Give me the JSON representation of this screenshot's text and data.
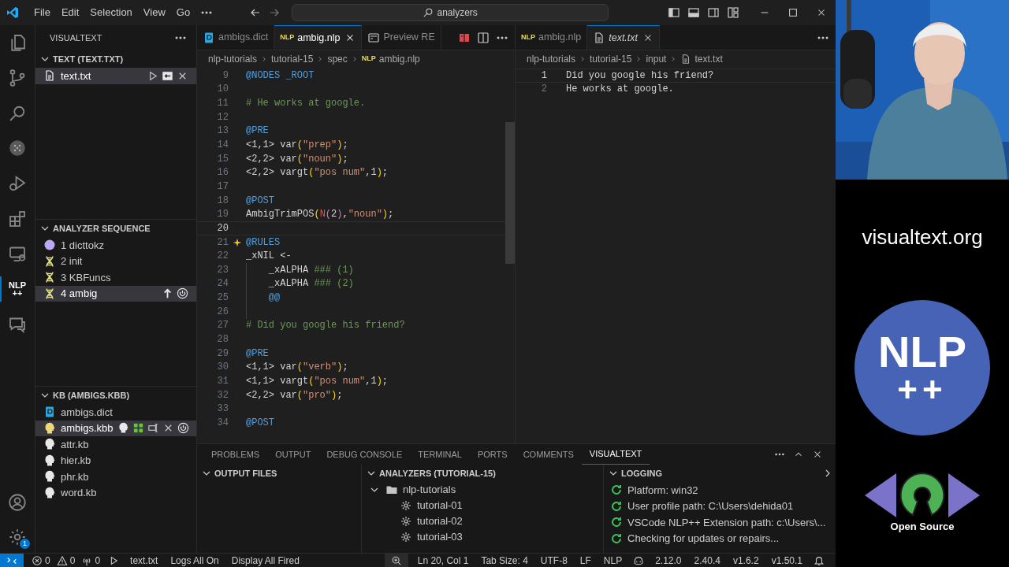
{
  "title_bar": {
    "menus": [
      "File",
      "Edit",
      "Selection",
      "View",
      "Go"
    ],
    "command_center": "analyzers"
  },
  "activity_bar": [
    {
      "kind": "explorer",
      "selected": false
    },
    {
      "kind": "source_control",
      "selected": false
    },
    {
      "kind": "search",
      "selected": false
    },
    {
      "kind": "dots",
      "selected": false
    },
    {
      "kind": "debug",
      "selected": false
    },
    {
      "kind": "extensions",
      "selected": false
    },
    {
      "kind": "remote",
      "selected": false
    },
    {
      "kind": "text",
      "label": "NLP ++",
      "selected": true
    },
    {
      "kind": "chat",
      "selected": false
    }
  ],
  "activity_bottom": [
    {
      "kind": "account"
    },
    {
      "kind": "gear",
      "badge": "1"
    }
  ],
  "sidebar": {
    "title": "VISUALTEXT",
    "sections": [
      {
        "title": "TEXT (TEXT.TXT)",
        "expanded": true,
        "items": [
          {
            "label": "text.txt",
            "kind": "file",
            "selected": true
          }
        ]
      },
      {
        "title": "ANALYZER SEQUENCE",
        "expanded": true,
        "items": [
          {
            "label": "1 dicttokz",
            "kind": "circle",
            "selected": false
          },
          {
            "label": "2 init",
            "kind": "dna",
            "selected": false
          },
          {
            "label": "3 KBFuncs",
            "kind": "dna",
            "selected": false
          },
          {
            "label": "4 ambig",
            "kind": "dna",
            "selected": true
          }
        ]
      },
      {
        "title": "KB (AMBIGS.KBB)",
        "expanded": true,
        "items": [
          {
            "label": "ambigs.dict",
            "kind": "dict",
            "selected": false
          },
          {
            "label": "ambigs.kbb",
            "kind": "head",
            "color": "#ecd77c",
            "selected": true
          },
          {
            "label": "attr.kb",
            "kind": "head",
            "color": "#e8e8e8",
            "selected": false
          },
          {
            "label": "hier.kb",
            "kind": "head",
            "color": "#e8e8e8",
            "selected": false
          },
          {
            "label": "phr.kb",
            "kind": "head",
            "color": "#e8e8e8",
            "selected": false
          },
          {
            "label": "word.kb",
            "kind": "head",
            "color": "#e8e8e8",
            "selected": false
          }
        ]
      }
    ]
  },
  "editor_groups": [
    {
      "kind": "code",
      "tabs": [
        {
          "label": "ambigs.dict",
          "kind": "dict",
          "selected": false,
          "italic": false
        },
        {
          "label": "ambig.nlp",
          "badge": "NLP",
          "selected": true,
          "italic": false
        },
        {
          "label": "Preview RE",
          "kind": "preview",
          "selected": false,
          "italic": false
        }
      ],
      "breadcrumbs": [
        {
          "label": "nlp-tutorials"
        },
        {
          "label": "tutorial-15"
        },
        {
          "label": "spec"
        },
        {
          "label": "ambig.nlp",
          "badge": "NLP"
        }
      ],
      "lines": [
        {
          "n": "9",
          "current": false,
          "hint": false,
          "guide": false,
          "tokens": [
            {
              "kind": "kw",
              "text": "@NODES _ROOT"
            }
          ]
        },
        {
          "n": "10",
          "current": false,
          "hint": false,
          "guide": false
        },
        {
          "n": "11",
          "current": false,
          "hint": false,
          "guide": false,
          "tokens": [
            {
              "kind": "comment",
              "text": "# He works at google."
            }
          ]
        },
        {
          "n": "12",
          "current": false,
          "hint": false,
          "guide": false
        },
        {
          "n": "13",
          "current": false,
          "hint": false,
          "guide": false,
          "tokens": [
            {
              "kind": "kw",
              "text": "@PRE"
            }
          ]
        },
        {
          "n": "14",
          "current": false,
          "hint": false,
          "guide": false,
          "tokens": [
            {
              "kind": "plain",
              "text": "<1,1> var"
            },
            {
              "kind": "paren",
              "text": "("
            },
            {
              "kind": "string",
              "text": "\"prep\""
            },
            {
              "kind": "paren",
              "text": ")"
            },
            {
              "kind": "plain",
              "text": ";"
            }
          ]
        },
        {
          "n": "15",
          "current": false,
          "hint": false,
          "guide": false,
          "tokens": [
            {
              "kind": "plain",
              "text": "<2,2> var"
            },
            {
              "kind": "paren",
              "text": "("
            },
            {
              "kind": "string",
              "text": "\"noun\""
            },
            {
              "kind": "paren",
              "text": ")"
            },
            {
              "kind": "plain",
              "text": ";"
            }
          ]
        },
        {
          "n": "16",
          "current": false,
          "hint": false,
          "guide": false,
          "tokens": [
            {
              "kind": "plain",
              "text": "<2,2> vargt"
            },
            {
              "kind": "paren",
              "text": "("
            },
            {
              "kind": "string",
              "text": "\"pos num\""
            },
            {
              "kind": "plain",
              "text": ",1"
            },
            {
              "kind": "paren",
              "text": ")"
            },
            {
              "kind": "plain",
              "text": ";"
            }
          ]
        },
        {
          "n": "17",
          "current": false,
          "hint": false,
          "guide": false
        },
        {
          "n": "18",
          "current": false,
          "hint": false,
          "guide": false,
          "tokens": [
            {
              "kind": "kw",
              "text": "@POST"
            }
          ]
        },
        {
          "n": "19",
          "current": false,
          "hint": false,
          "guide": false,
          "tokens": [
            {
              "kind": "plain",
              "text": "AmbigTrimPOS"
            },
            {
              "kind": "paren",
              "text": "("
            },
            {
              "kind": "macro",
              "text": "N"
            },
            {
              "kind": "paren2",
              "text": "("
            },
            {
              "kind": "plain",
              "text": "2"
            },
            {
              "kind": "paren2",
              "text": ")"
            },
            {
              "kind": "plain",
              "text": ","
            },
            {
              "kind": "string",
              "text": "\"noun\""
            },
            {
              "kind": "paren",
              "text": ")"
            },
            {
              "kind": "plain",
              "text": ";"
            }
          ]
        },
        {
          "n": "20",
          "current": true,
          "hint": false,
          "guide": false
        },
        {
          "n": "21",
          "current": false,
          "hint": true,
          "guide": false,
          "tokens": [
            {
              "kind": "kw",
              "text": "@RULES"
            }
          ]
        },
        {
          "n": "22",
          "current": false,
          "hint": false,
          "guide": false,
          "tokens": [
            {
              "kind": "plain",
              "text": "_xNIL <-"
            }
          ]
        },
        {
          "n": "23",
          "current": false,
          "hint": false,
          "guide": true,
          "tokens": [
            {
              "kind": "plain",
              "text": "_xALPHA "
            },
            {
              "kind": "comment",
              "text": "### (1)"
            }
          ]
        },
        {
          "n": "24",
          "current": false,
          "hint": false,
          "guide": true,
          "tokens": [
            {
              "kind": "plain",
              "text": "_xALPHA "
            },
            {
              "kind": "comment",
              "text": "### (2)"
            }
          ]
        },
        {
          "n": "25",
          "current": false,
          "hint": false,
          "guide": true,
          "tokens": [
            {
              "kind": "kw",
              "text": "@@"
            }
          ]
        },
        {
          "n": "26",
          "current": false,
          "hint": false,
          "guide": true
        },
        {
          "n": "27",
          "current": false,
          "hint": false,
          "guide": false,
          "tokens": [
            {
              "kind": "comment",
              "text": "# Did you google his friend?"
            }
          ]
        },
        {
          "n": "28",
          "current": false,
          "hint": false,
          "guide": false
        },
        {
          "n": "29",
          "current": false,
          "hint": false,
          "guide": false,
          "tokens": [
            {
              "kind": "kw",
              "text": "@PRE"
            }
          ]
        },
        {
          "n": "30",
          "current": false,
          "hint": false,
          "guide": false,
          "tokens": [
            {
              "kind": "plain",
              "text": "<1,1> var"
            },
            {
              "kind": "paren",
              "text": "("
            },
            {
              "kind": "string",
              "text": "\"verb\""
            },
            {
              "kind": "paren",
              "text": ")"
            },
            {
              "kind": "plain",
              "text": ";"
            }
          ]
        },
        {
          "n": "31",
          "current": false,
          "hint": false,
          "guide": false,
          "tokens": [
            {
              "kind": "plain",
              "text": "<1,1> vargt"
            },
            {
              "kind": "paren",
              "text": "("
            },
            {
              "kind": "string",
              "text": "\"pos num\""
            },
            {
              "kind": "plain",
              "text": ",1"
            },
            {
              "kind": "paren",
              "text": ")"
            },
            {
              "kind": "plain",
              "text": ";"
            }
          ]
        },
        {
          "n": "32",
          "current": false,
          "hint": false,
          "guide": false,
          "tokens": [
            {
              "kind": "plain",
              "text": "<2,2> var"
            },
            {
              "kind": "paren",
              "text": "("
            },
            {
              "kind": "string",
              "text": "\"pro\""
            },
            {
              "kind": "paren",
              "text": ")"
            },
            {
              "kind": "plain",
              "text": ";"
            }
          ]
        },
        {
          "n": "33",
          "current": false,
          "hint": false,
          "guide": false
        },
        {
          "n": "34",
          "current": false,
          "hint": false,
          "guide": false,
          "tokens": [
            {
              "kind": "kw",
              "text": "@POST"
            }
          ]
        }
      ]
    },
    {
      "kind": "text",
      "tabs": [
        {
          "label": "ambig.nlp",
          "badge": "NLP",
          "selected": false,
          "italic": false
        },
        {
          "label": "text.txt",
          "kind": "file",
          "selected": true,
          "italic": true
        }
      ],
      "breadcrumbs": [
        {
          "label": "nlp-tutorials"
        },
        {
          "label": "tutorial-15"
        },
        {
          "label": "input"
        },
        {
          "label": "text.txt",
          "kind": "file"
        }
      ],
      "lines": [
        {
          "n": "1",
          "current": true,
          "text": "Did you google his friend?"
        },
        {
          "n": "2",
          "current": false,
          "text": "He works at google."
        }
      ]
    }
  ],
  "panel": {
    "tabs": [
      {
        "label": "PROBLEMS",
        "selected": false
      },
      {
        "label": "OUTPUT",
        "selected": false
      },
      {
        "label": "DEBUG CONSOLE",
        "selected": false
      },
      {
        "label": "TERMINAL",
        "selected": false
      },
      {
        "label": "PORTS",
        "selected": false
      },
      {
        "label": "COMMENTS",
        "selected": false
      },
      {
        "label": "VISUALTEXT",
        "selected": true
      }
    ],
    "views": [
      {
        "title": "OUTPUT FILES",
        "expanded": true
      },
      {
        "title": "ANALYZERS (TUTORIAL-15)",
        "expanded": true,
        "tree": [
          {
            "label": "nlp-tutorials",
            "kind": "folder",
            "expanded": true,
            "children": [
              {
                "label": "tutorial-01",
                "kind": "analyzer"
              },
              {
                "label": "tutorial-02",
                "kind": "analyzer"
              },
              {
                "label": "tutorial-03",
                "kind": "analyzer"
              }
            ]
          }
        ]
      },
      {
        "title": "LOGGING",
        "expanded": true,
        "entries": [
          "Platform: win32",
          "User profile path: C:\\Users\\dehida01",
          "VSCode NLP++ Extension path: c:\\Users\\...",
          "Checking for updates or repairs..."
        ]
      }
    ]
  },
  "status_bar": {
    "left": [
      {
        "kind": "remote"
      },
      {
        "kind": "errors",
        "text": "0"
      },
      {
        "kind": "warnings",
        "text": "0"
      },
      {
        "kind": "ports",
        "text": "0"
      },
      {
        "kind": "play"
      },
      {
        "kind": "text",
        "text": "text.txt"
      },
      {
        "kind": "text",
        "text": "Logs All On"
      },
      {
        "kind": "text",
        "text": "Display All Fired"
      }
    ],
    "right": [
      {
        "kind": "zoom"
      },
      {
        "kind": "text",
        "text": "Ln 20, Col 1"
      },
      {
        "kind": "text",
        "text": "Tab Size: 4"
      },
      {
        "kind": "text",
        "text": "UTF-8"
      },
      {
        "kind": "text",
        "text": "LF"
      },
      {
        "kind": "text",
        "text": "NLP"
      },
      {
        "kind": "copilot"
      },
      {
        "kind": "text",
        "text": "2.12.0"
      },
      {
        "kind": "text",
        "text": "2.40.4"
      },
      {
        "kind": "text",
        "text": "v1.6.2"
      },
      {
        "kind": "text",
        "text": "v1.50.1"
      },
      {
        "kind": "bell"
      }
    ]
  },
  "stream_overlay": {
    "webcam": {
      "kind": "picture"
    },
    "site": "visualtext.org",
    "logo": [
      "NLP",
      "++"
    ],
    "open_source": "Open Source"
  }
}
